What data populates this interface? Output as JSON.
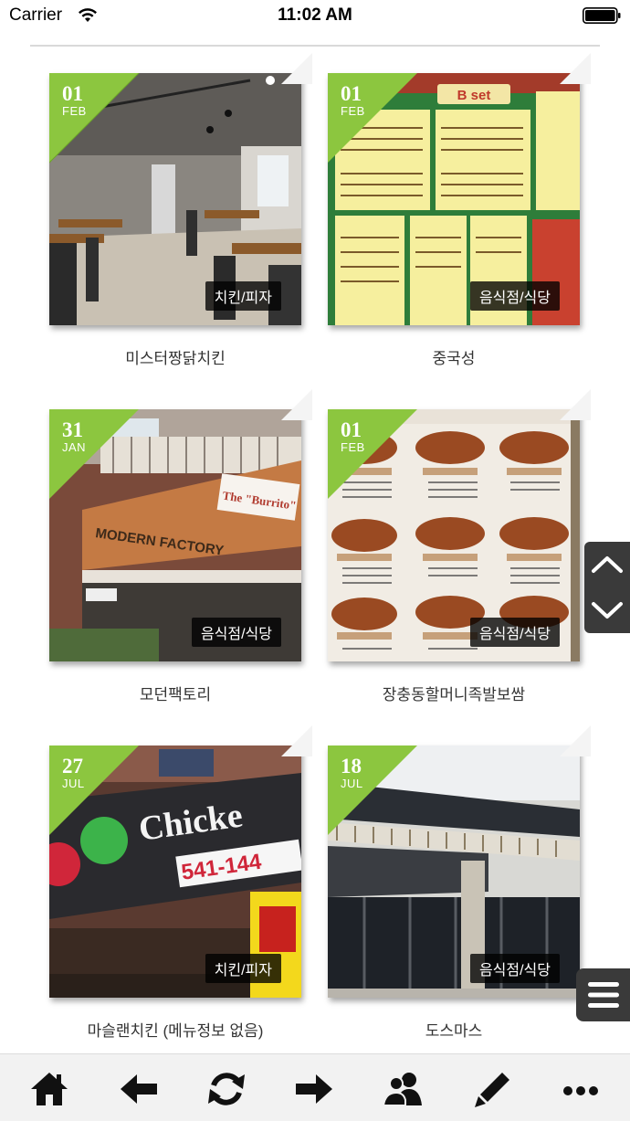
{
  "status_bar": {
    "carrier": "Carrier",
    "time": "11:02 AM"
  },
  "cards": [
    {
      "day": "01",
      "month": "FEB",
      "category": "치킨/피자",
      "name": "미스터짱닭치킨"
    },
    {
      "day": "01",
      "month": "FEB",
      "category": "음식점/식당",
      "name": "중국성"
    },
    {
      "day": "31",
      "month": "JAN",
      "category": "음식점/식당",
      "name": "모던팩토리"
    },
    {
      "day": "01",
      "month": "FEB",
      "category": "음식점/식당",
      "name": "장충동할머니족발보쌈"
    },
    {
      "day": "27",
      "month": "JUL",
      "category": "치킨/피자",
      "name": "마슬랜치킨 (메뉴정보 없음)"
    },
    {
      "day": "18",
      "month": "JUL",
      "category": "음식점/식당",
      "name": "도스마스"
    }
  ],
  "photo_text": {
    "menu_set": "B set",
    "factory_sign": "MODERN FACTORY",
    "burrito_sign": "The \"Burrito\"",
    "chicken_sign": "Chicke",
    "phone": "541-144"
  },
  "toolbar": {
    "icons": [
      "home-icon",
      "back-arrow-icon",
      "refresh-icon",
      "forward-arrow-icon",
      "users-icon",
      "pencil-icon",
      "more-icon"
    ]
  },
  "colors": {
    "ribbon": "#8cc63f",
    "tag_bg": "#000000",
    "toolbar_icon": "#111111"
  }
}
